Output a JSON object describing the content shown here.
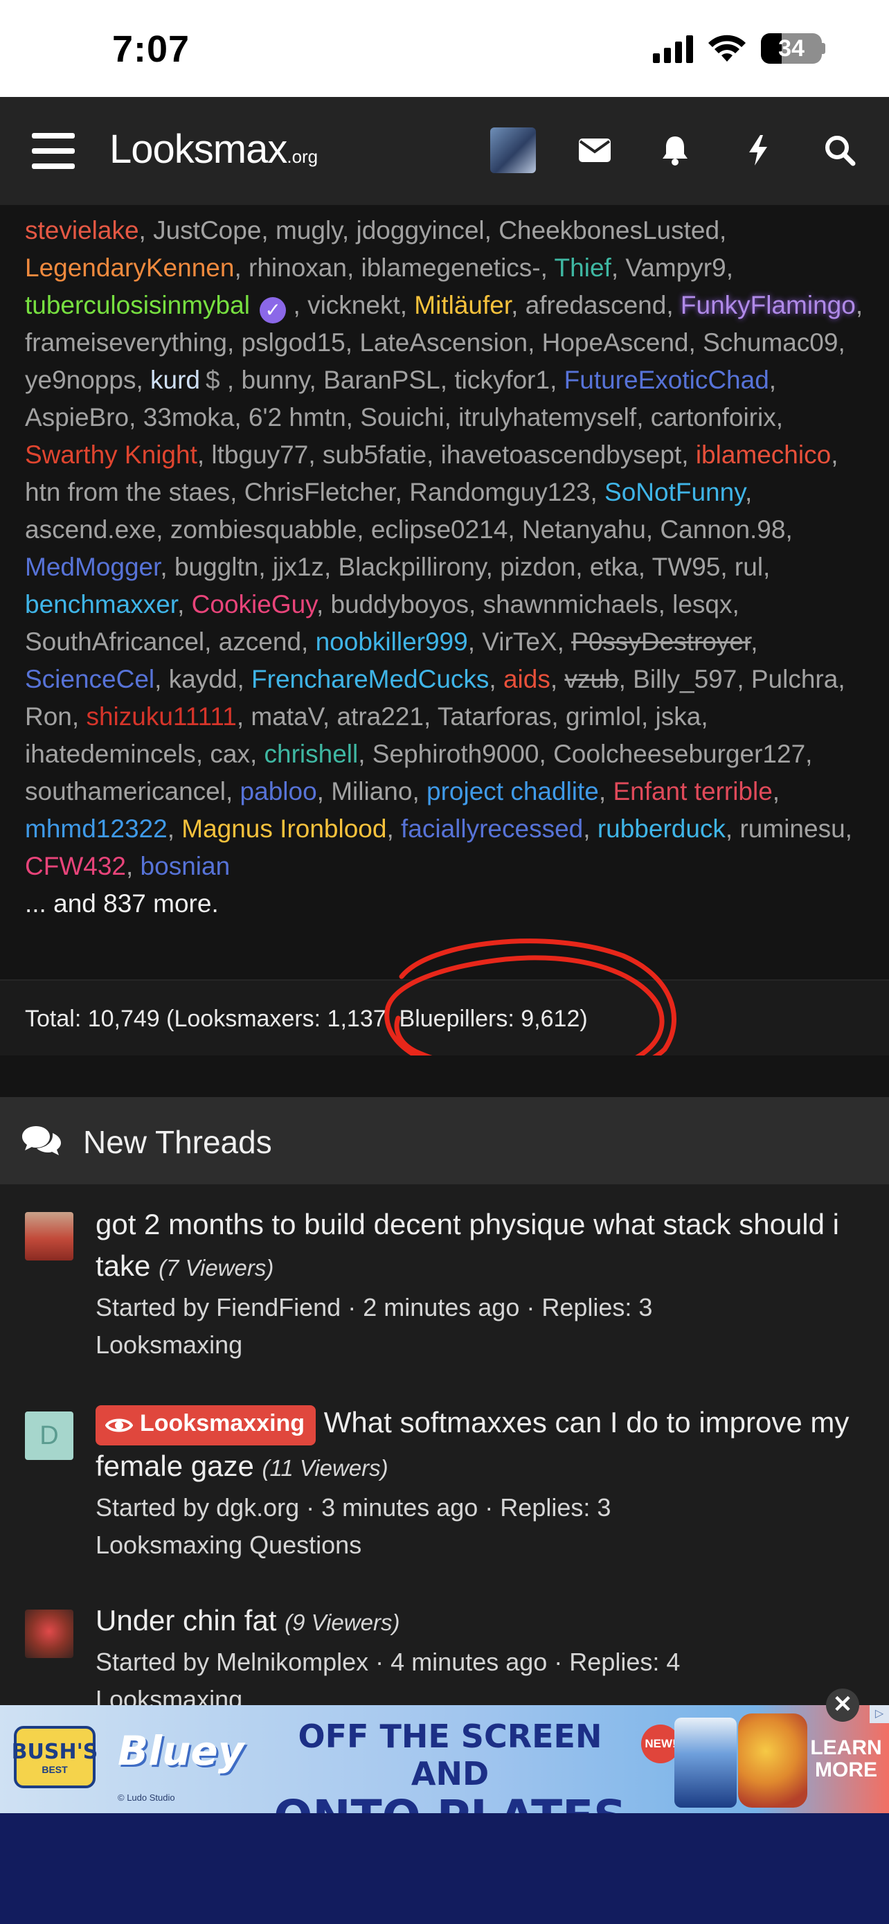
{
  "status_bar": {
    "time": "7:07",
    "battery": "34",
    "battery_level": 0.34
  },
  "header": {
    "logo_main": "Lo​oksmax",
    "logo_text": "Looksmax",
    "logo_suffix": ".org",
    "icons": [
      "menu-icon",
      "avatar",
      "envelope-icon",
      "bell-icon",
      "lightning-icon",
      "search-icon"
    ]
  },
  "online_members": [
    {
      "n": "stevielake",
      "c": "#e55844"
    },
    {
      "n": "JustCope",
      "c": ""
    },
    {
      "n": "mugly",
      "c": ""
    },
    {
      "n": "jdoggyincel",
      "c": ""
    },
    {
      "n": "CheekbonesLusted",
      "c": ""
    },
    {
      "n": "LegendaryKennen",
      "c": "#f08a3e"
    },
    {
      "n": "rhinoxan",
      "c": ""
    },
    {
      "n": "iblamegenetics-",
      "c": ""
    },
    {
      "n": "Thief",
      "c": "#3fb8a3"
    },
    {
      "n": "Vampyr9",
      "c": ""
    },
    {
      "n": "tuberculosisinmybal",
      "c": "#77e040",
      "badge": "verified"
    },
    {
      "n": "vicknekt",
      "c": ""
    },
    {
      "n": "Mitläufer",
      "c": "#f7c23c"
    },
    {
      "n": "afredascend",
      "c": ""
    },
    {
      "n": "FunkyFlamingo",
      "c": "#b08ae8",
      "glow": true
    },
    {
      "n": "frameiseverything",
      "c": ""
    },
    {
      "n": "pslgod15",
      "c": ""
    },
    {
      "n": "LateAscension",
      "c": ""
    },
    {
      "n": "HopeAscend",
      "c": ""
    },
    {
      "n": "Schumac09",
      "c": ""
    },
    {
      "n": "ye9nopps",
      "c": ""
    },
    {
      "n": "kurd",
      "c": "#cfe0f5",
      "badge": "dollar"
    },
    {
      "n": "bunny",
      "c": ""
    },
    {
      "n": "BaranPSL",
      "c": ""
    },
    {
      "n": "tickyfor1",
      "c": ""
    },
    {
      "n": "FutureExoticChad",
      "c": "#5773d8"
    },
    {
      "n": "AspieBro",
      "c": ""
    },
    {
      "n": "33moka",
      "c": ""
    },
    {
      "n": "6'2 hmtn",
      "c": ""
    },
    {
      "n": "Souichi",
      "c": ""
    },
    {
      "n": "itrulyhatemyself",
      "c": ""
    },
    {
      "n": "cartonfoirix",
      "c": ""
    },
    {
      "n": "Swarthy Knight",
      "c": "#e0452f"
    },
    {
      "n": "ltbguy77",
      "c": ""
    },
    {
      "n": "sub5fatie",
      "c": ""
    },
    {
      "n": "ihavetoascendbysept",
      "c": ""
    },
    {
      "n": "iblamechico",
      "c": "#e8503a"
    },
    {
      "n": "htn from the staes",
      "c": ""
    },
    {
      "n": "ChrisFletcher",
      "c": ""
    },
    {
      "n": "Randomguy123",
      "c": ""
    },
    {
      "n": "SoNotFunny",
      "c": "#3fb5e8"
    },
    {
      "n": "ascend.exe",
      "c": ""
    },
    {
      "n": "zombiesquabble",
      "c": ""
    },
    {
      "n": "eclipse0214",
      "c": ""
    },
    {
      "n": "Netanyahu",
      "c": ""
    },
    {
      "n": "Cannon.98",
      "c": ""
    },
    {
      "n": "MedMogger",
      "c": "#5773d8"
    },
    {
      "n": "buggltn",
      "c": ""
    },
    {
      "n": "jjx1z",
      "c": ""
    },
    {
      "n": "Blackpillirony",
      "c": ""
    },
    {
      "n": "pizdon",
      "c": ""
    },
    {
      "n": "etka",
      "c": ""
    },
    {
      "n": "TW95",
      "c": ""
    },
    {
      "n": "rul",
      "c": ""
    },
    {
      "n": "benchmaxxer",
      "c": "#3fb5e8"
    },
    {
      "n": "CookieGuy",
      "c": "#e8447a"
    },
    {
      "n": "buddyboyos",
      "c": ""
    },
    {
      "n": "shawnmichaels",
      "c": ""
    },
    {
      "n": "lesqx",
      "c": ""
    },
    {
      "n": "SouthAfricancel",
      "c": ""
    },
    {
      "n": "azcend",
      "c": ""
    },
    {
      "n": "noobkiller999",
      "c": "#3fb5e8"
    },
    {
      "n": "VirTeX",
      "c": ""
    },
    {
      "n": "P0ssyDestroyer",
      "c": "",
      "strike": true
    },
    {
      "n": "ScienceCel",
      "c": "#5773d8"
    },
    {
      "n": "kaydd",
      "c": ""
    },
    {
      "n": "FrenchareMedCucks",
      "c": "#3fb5e8"
    },
    {
      "n": "aids",
      "c": "#e8503a"
    },
    {
      "n": "vzub",
      "c": "",
      "strike": true
    },
    {
      "n": "Billy_597",
      "c": ""
    },
    {
      "n": "Pulchra",
      "c": ""
    },
    {
      "n": "Ron",
      "c": ""
    },
    {
      "n": "shizuku11111",
      "c": "#d6352a"
    },
    {
      "n": "mataV",
      "c": ""
    },
    {
      "n": "atra221",
      "c": ""
    },
    {
      "n": "Tatarforas",
      "c": ""
    },
    {
      "n": "grimlol",
      "c": ""
    },
    {
      "n": "jska",
      "c": ""
    },
    {
      "n": "ihatedemincels",
      "c": ""
    },
    {
      "n": "cax",
      "c": ""
    },
    {
      "n": "chrishell",
      "c": "#3fb8a3"
    },
    {
      "n": "Sephiroth9000",
      "c": ""
    },
    {
      "n": "Coolcheeseburger127",
      "c": ""
    },
    {
      "n": "southamericancel",
      "c": ""
    },
    {
      "n": "pabloo",
      "c": "#5773d8"
    },
    {
      "n": "Miliano",
      "c": ""
    },
    {
      "n": "project chadlite",
      "c": "#3f9ae8"
    },
    {
      "n": "Enfant terrible",
      "c": "#e04a5a"
    },
    {
      "n": "mhmd12322",
      "c": "#3f9ae8"
    },
    {
      "n": "Magnus Ironblood",
      "c": "#f7c23c"
    },
    {
      "n": "faciallyrecessed",
      "c": "#5773d8"
    },
    {
      "n": "rubberduck",
      "c": "#3fb5e8"
    },
    {
      "n": "ruminesu",
      "c": ""
    },
    {
      "n": "CFW432",
      "c": "#e8447a"
    },
    {
      "n": "bosnian",
      "c": "#5773d8"
    }
  ],
  "online_more": "... and 837 more.",
  "online_total": "Total: 10,749 (Looksmaxers: 1,137, Bluepillers: 9,612)",
  "new_threads": {
    "title": "New Threads",
    "items": [
      {
        "title": "got 2 months to build decent physique what stack should i take",
        "viewers": "(7 Viewers)",
        "meta": "Started by FiendFiend · 2 minutes ago · Replies: 3",
        "forum": "Looksmaxing",
        "prefix": "",
        "avatar_letter": "",
        "avatar_color": "#b86a4a"
      },
      {
        "title": "What softmaxxes can I do to improve my female gaze",
        "viewers": "(11 Viewers)",
        "meta": "Started by dgk.org · 3 minutes ago · Replies: 3",
        "forum": "Looksmaxing Questions",
        "prefix": "Looksmaxxing",
        "avatar_letter": "D",
        "avatar_color": "#a6d6cc"
      },
      {
        "title": "Under chin fat",
        "viewers": "(9 Viewers)",
        "meta": "Started by Melnikomplex · 4 minutes ago · Replies: 4",
        "forum": "Looksmaxing",
        "prefix": "",
        "avatar_letter": "",
        "avatar_color": "#7a3b2e"
      }
    ]
  },
  "ad": {
    "brand_top": "BUSH'S",
    "brand_bottom": "BEST",
    "brand2": "Bluey",
    "credit": "© Ludo Studio",
    "headline_1": "OFF THE SCREEN AND",
    "headline_2": "ONTO PLATES",
    "new_badge": "NEW!",
    "cta": "LEARN MORE",
    "close": "✕",
    "choices": "▷"
  }
}
